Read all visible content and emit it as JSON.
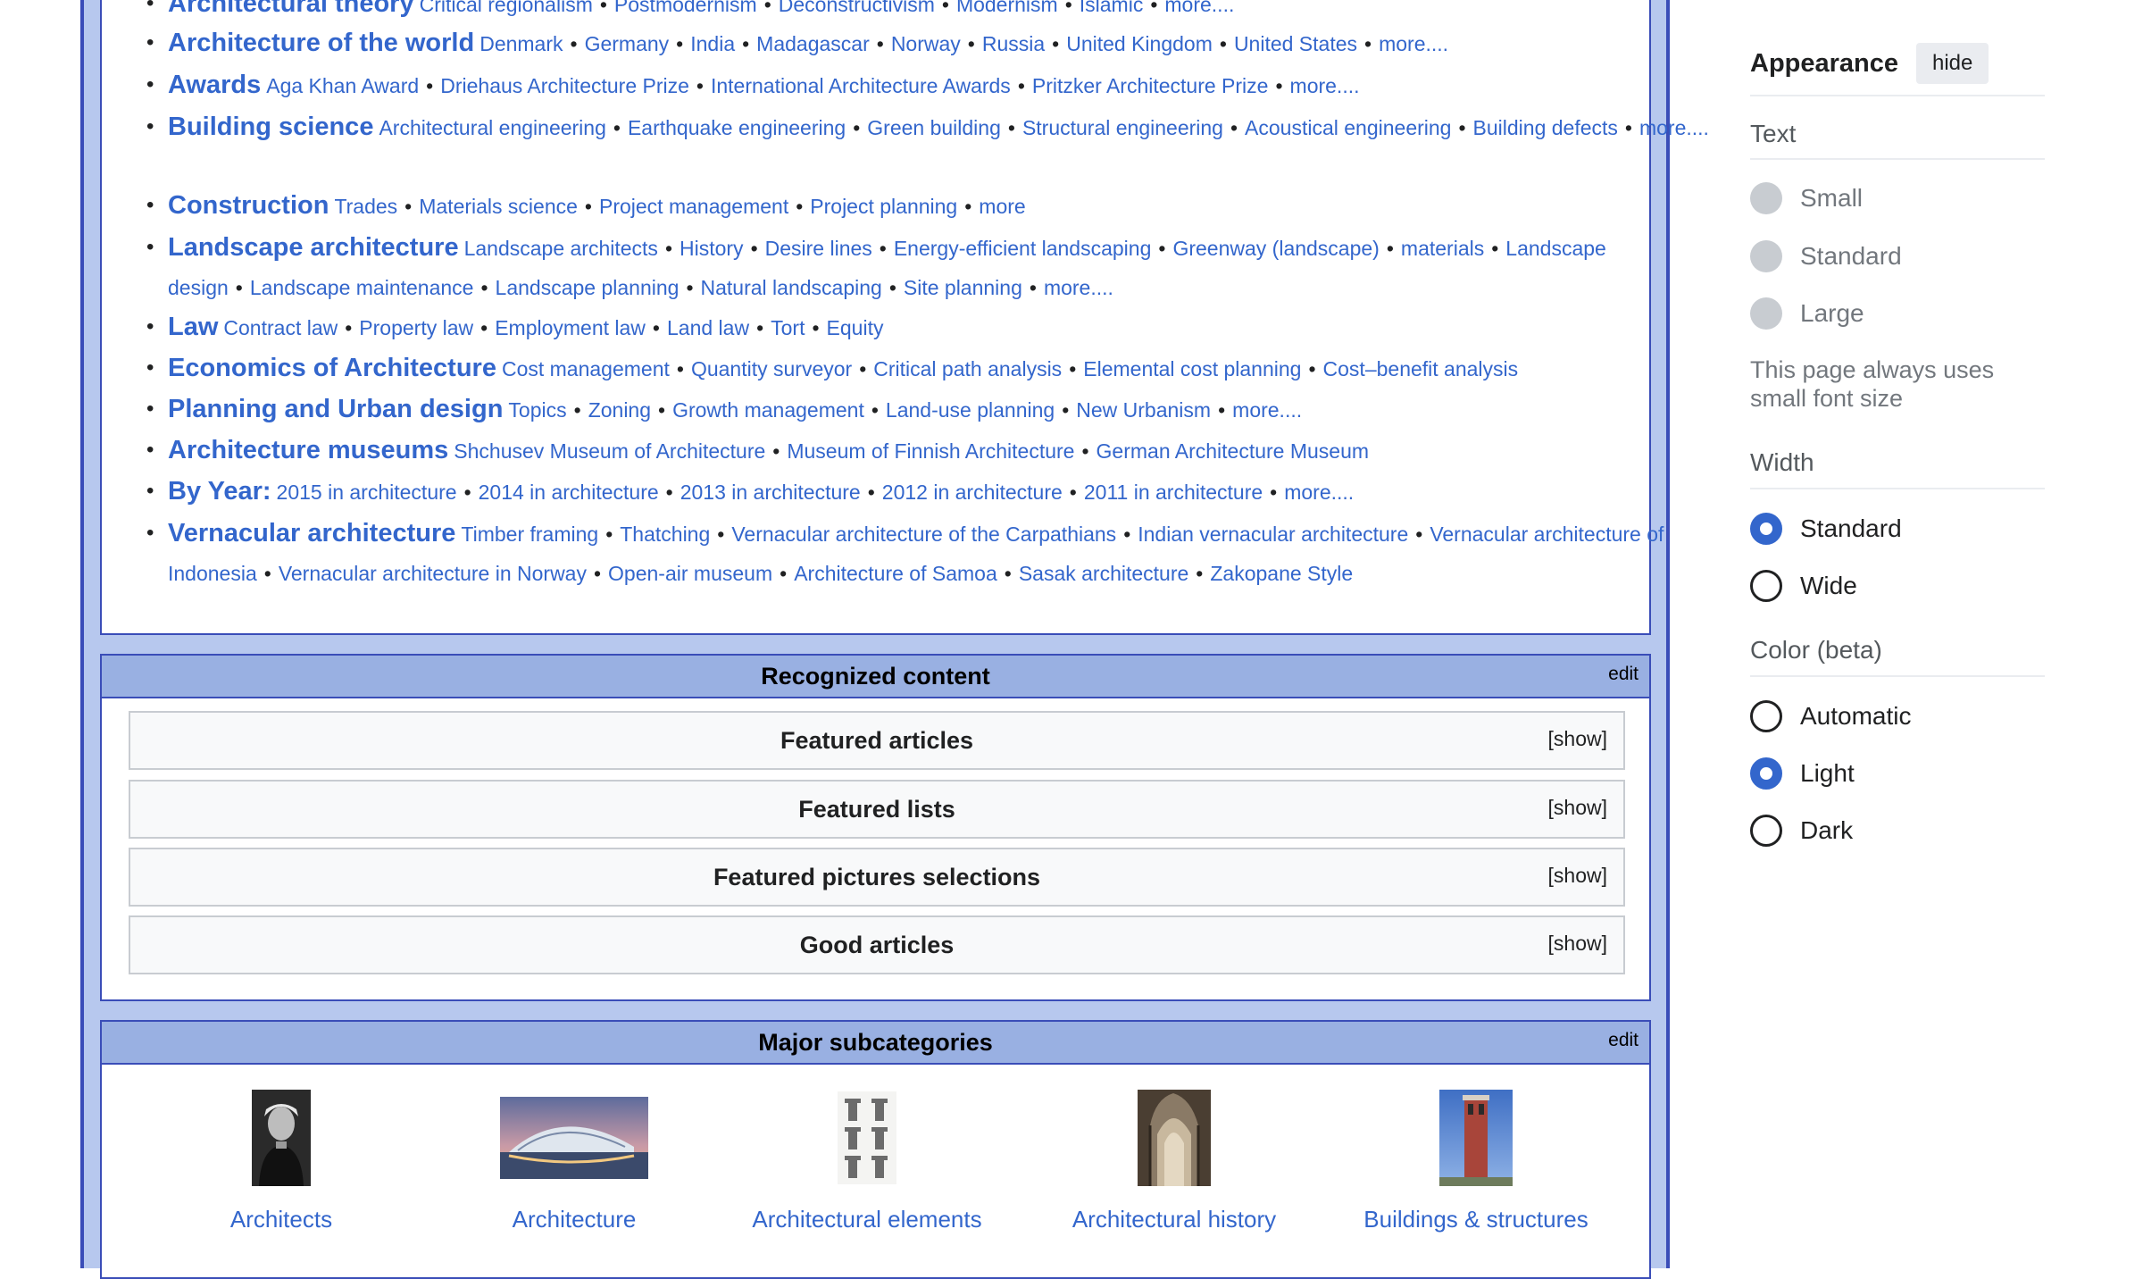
{
  "topics": [
    {
      "head": "Architectural theory",
      "items": [
        "Critical regionalism",
        "Postmodernism",
        "Deconstructivism",
        "Modernism",
        "Islamic",
        "more...."
      ]
    },
    {
      "head": "Architecture of the world",
      "items": [
        "Denmark",
        "Germany",
        "India",
        "Madagascar",
        "Norway",
        "Russia",
        "United Kingdom",
        "United States",
        "more...."
      ]
    },
    {
      "head": "Awards",
      "items": [
        "Aga Khan Award",
        "Driehaus Architecture Prize",
        "International Architecture Awards",
        "Pritzker Architecture Prize",
        "more...."
      ]
    },
    {
      "head": "Building science",
      "items": [
        "Architectural engineering",
        "Earthquake engineering",
        "Green building",
        "Structural engineering",
        "Acoustical engineering",
        "Building defects",
        "more...."
      ]
    },
    {
      "head": "Construction",
      "items": [
        "Trades",
        "Materials science",
        "Project management",
        "Project planning",
        "more"
      ]
    },
    {
      "head": "Landscape architecture",
      "items": [
        "Landscape architects",
        "History",
        "Desire lines",
        "Energy-efficient landscaping",
        "Greenway (landscape)",
        "materials",
        "Landscape design",
        "Landscape maintenance",
        "Landscape planning",
        "Natural landscaping",
        "Site planning",
        "more...."
      ]
    },
    {
      "head": "Law",
      "items": [
        "Contract law",
        "Property law",
        "Employment law",
        "Land law",
        "Tort",
        "Equity"
      ]
    },
    {
      "head": "Economics of Architecture",
      "items": [
        "Cost management",
        "Quantity surveyor",
        "Critical path analysis",
        "Elemental cost planning",
        "Cost–benefit analysis"
      ]
    },
    {
      "head": "Planning and Urban design",
      "items": [
        "Topics",
        "Zoning",
        "Growth management",
        "Land-use planning",
        "New Urbanism",
        "more...."
      ]
    },
    {
      "head": "Architecture museums",
      "items": [
        "Shchusev Museum of Architecture",
        "Museum of Finnish Architecture",
        "German Architecture Museum"
      ]
    },
    {
      "head": "By Year:",
      "items": [
        "2015 in architecture",
        "2014 in architecture",
        "2013 in architecture",
        "2012 in architecture",
        "2011 in architecture",
        "more...."
      ]
    },
    {
      "head": "Vernacular architecture",
      "items": [
        "Timber framing",
        "Thatching",
        "Vernacular architecture of the Carpathians",
        "Indian vernacular architecture",
        "Vernacular architecture of Indonesia",
        "Vernacular architecture in Norway",
        "Open-air museum",
        "Architecture of Samoa",
        "Sasak architecture",
        "Zakopane Style"
      ]
    }
  ],
  "recognized": {
    "title": "Recognized content",
    "edit": "edit",
    "sections": [
      {
        "title": "Featured articles",
        "toggle": "[show]"
      },
      {
        "title": "Featured lists",
        "toggle": "[show]"
      },
      {
        "title": "Featured pictures selections",
        "toggle": "[show]"
      },
      {
        "title": "Good articles",
        "toggle": "[show]"
      }
    ]
  },
  "subcategories": {
    "title": "Major subcategories",
    "edit": "edit",
    "items": [
      {
        "label": "Architects",
        "thumb": "portrait-photo"
      },
      {
        "label": "Architecture",
        "thumb": "modern-building-photo"
      },
      {
        "label": "Architectural elements",
        "thumb": "column-orders-drawing"
      },
      {
        "label": "Architectural history",
        "thumb": "gothic-interior-photo"
      },
      {
        "label": "Buildings & structures",
        "thumb": "tower-photo"
      }
    ]
  },
  "appearance": {
    "title": "Appearance",
    "hide": "hide",
    "text_heading": "Text",
    "text_options": [
      {
        "label": "Small",
        "state": "disabled"
      },
      {
        "label": "Standard",
        "state": "disabled"
      },
      {
        "label": "Large",
        "state": "disabled"
      }
    ],
    "text_note": "This page always uses small font size",
    "width_heading": "Width",
    "width_options": [
      {
        "label": "Standard",
        "state": "on"
      },
      {
        "label": "Wide",
        "state": "off"
      }
    ],
    "color_heading": "Color (beta)",
    "color_options": [
      {
        "label": "Automatic",
        "state": "off"
      },
      {
        "label": "Light",
        "state": "on"
      },
      {
        "label": "Dark",
        "state": "off"
      }
    ]
  },
  "colors": {
    "link": "#3366cc",
    "header_bg": "#99b0e2",
    "frame": "#3a4db8",
    "portal_bg": "#b7c8ee",
    "radio_on": "#3366cc"
  }
}
